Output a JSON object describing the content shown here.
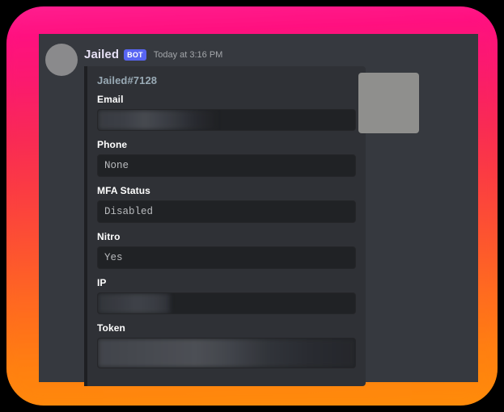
{
  "message": {
    "username": "Jailed",
    "bot_badge": "BOT",
    "timestamp": "Today at 3:16 PM",
    "avatar_alt": "user-avatar-mugshot"
  },
  "embed": {
    "title": "Jailed#7128",
    "accent_color": "#1e1f22",
    "background_color": "#2f3136",
    "thumbnail_alt": "user-thumbnail-mugshot",
    "fields": [
      {
        "name": "Email",
        "value": "",
        "redacted": true
      },
      {
        "name": "Phone",
        "value": "None",
        "redacted": false
      },
      {
        "name": "MFA Status",
        "value": "Disabled",
        "redacted": false
      },
      {
        "name": "Nitro",
        "value": "Yes",
        "redacted": false
      },
      {
        "name": "IP",
        "value": "",
        "redacted": true
      },
      {
        "name": "Token",
        "value": "",
        "redacted": true
      }
    ]
  },
  "theme": {
    "chat_background": "#36393f",
    "code_block_background": "#202225",
    "bot_badge_color": "#5865f2",
    "username_color": "#e6e0f5",
    "timestamp_color": "#a3a6aa",
    "embed_title_color": "#99aab5",
    "field_name_color": "#ffffff",
    "field_value_color": "#b9bbbe",
    "border_gradient_start": "#ff1f8f",
    "border_gradient_end": "#ff8c0a"
  }
}
